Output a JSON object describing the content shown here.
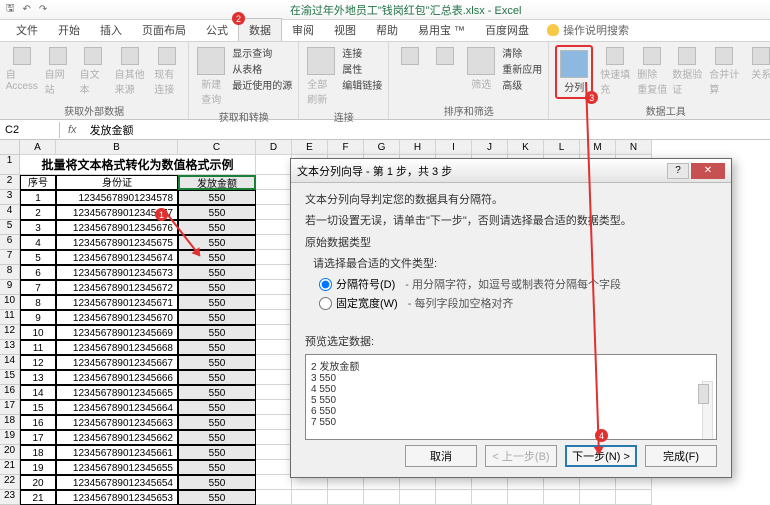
{
  "title": "在渝过年外地员工\"钱岗红包\"汇总表.xlsx - Excel",
  "qat": [
    "🖫",
    "↶",
    "↷"
  ],
  "menu": {
    "file": "文件",
    "home": "开始",
    "insert": "插入",
    "layout": "页面布局",
    "formula": "公式",
    "data": "数据",
    "review": "审阅",
    "view": "视图",
    "help": "帮助",
    "yiyong": "易用宝 ™",
    "baidu": "百度网盘"
  },
  "tellme": "操作说明搜索",
  "ribbon": {
    "g1": {
      "b1": "自 Access",
      "b2": "自网站",
      "b3": "自文本",
      "b4": "自其他来源",
      "b5": "现有连接",
      "label": "获取外部数据"
    },
    "g2": {
      "b1": "新建\n查询",
      "s1": "显示查询",
      "s2": "从表格",
      "s3": "最近使用的源",
      "label": "获取和转换"
    },
    "g3": {
      "b1": "全部刷新",
      "s1": "连接",
      "s2": "属性",
      "s3": "编辑链接",
      "label": "连接"
    },
    "g4": {
      "b1": "筛选",
      "s1": "清除",
      "s2": "重新应用",
      "s3": "高级",
      "label": "排序和筛选"
    },
    "g5": {
      "b1": "分列",
      "b2": "快速填充",
      "b3": "删除\n重复值",
      "b4": "数据验\n证",
      "b5": "合并计算",
      "b6": "关系",
      "label": "数据工具"
    }
  },
  "namebox": "C2",
  "formula": "发放金额",
  "sheet": {
    "cols": [
      "A",
      "B",
      "C",
      "D",
      "E",
      "F",
      "G",
      "H",
      "I",
      "J",
      "K",
      "L",
      "M",
      "N"
    ],
    "title": "批量将文本格式转化为数值格式示例",
    "headers": {
      "a": "序号",
      "b": "身份证",
      "c": "发放金额"
    },
    "rows": [
      {
        "n": "1",
        "id": "12345678901234578",
        "amt": "550"
      },
      {
        "n": "2",
        "id": "123456789012345677",
        "amt": "550"
      },
      {
        "n": "3",
        "id": "123456789012345676",
        "amt": "550"
      },
      {
        "n": "4",
        "id": "123456789012345675",
        "amt": "550"
      },
      {
        "n": "5",
        "id": "123456789012345674",
        "amt": "550"
      },
      {
        "n": "6",
        "id": "123456789012345673",
        "amt": "550"
      },
      {
        "n": "7",
        "id": "123456789012345672",
        "amt": "550"
      },
      {
        "n": "8",
        "id": "123456789012345671",
        "amt": "550"
      },
      {
        "n": "9",
        "id": "123456789012345670",
        "amt": "550"
      },
      {
        "n": "10",
        "id": "123456789012345669",
        "amt": "550"
      },
      {
        "n": "11",
        "id": "123456789012345668",
        "amt": "550"
      },
      {
        "n": "12",
        "id": "123456789012345667",
        "amt": "550"
      },
      {
        "n": "13",
        "id": "123456789012345666",
        "amt": "550"
      },
      {
        "n": "14",
        "id": "123456789012345665",
        "amt": "550"
      },
      {
        "n": "15",
        "id": "123456789012345664",
        "amt": "550"
      },
      {
        "n": "16",
        "id": "123456789012345663",
        "amt": "550"
      },
      {
        "n": "17",
        "id": "123456789012345662",
        "amt": "550"
      },
      {
        "n": "18",
        "id": "123456789012345661",
        "amt": "550"
      },
      {
        "n": "19",
        "id": "123456789012345655",
        "amt": "550"
      },
      {
        "n": "20",
        "id": "123456789012345654",
        "amt": "550"
      },
      {
        "n": "21",
        "id": "123456789012345653",
        "amt": "550"
      }
    ]
  },
  "dialog": {
    "title": "文本分列向导 - 第 1 步，共 3 步",
    "line1": "文本分列向导判定您的数据具有分隔符。",
    "line2": "若一切设置无误，请单击\"下一步\"，否则请选择最合适的数据类型。",
    "section1": "原始数据类型",
    "section1a": "请选择最合适的文件类型:",
    "opt1": "分隔符号(D)",
    "opt1desc": "- 用分隔字符，如逗号或制表符分隔每个字段",
    "opt2": "固定宽度(W)",
    "opt2desc": "- 每列字段加空格对齐",
    "section2": "预览选定数据:",
    "preview": [
      "2 发放金额",
      "3 550",
      "4 550",
      "5 550",
      "6 550",
      "7 550"
    ],
    "btnCancel": "取消",
    "btnBack": "< 上一步(B)",
    "btnNext": "下一步(N) >",
    "btnFinish": "完成(F)"
  },
  "badges": {
    "b1": "1",
    "b2": "2",
    "b3": "3",
    "b4": "4"
  }
}
